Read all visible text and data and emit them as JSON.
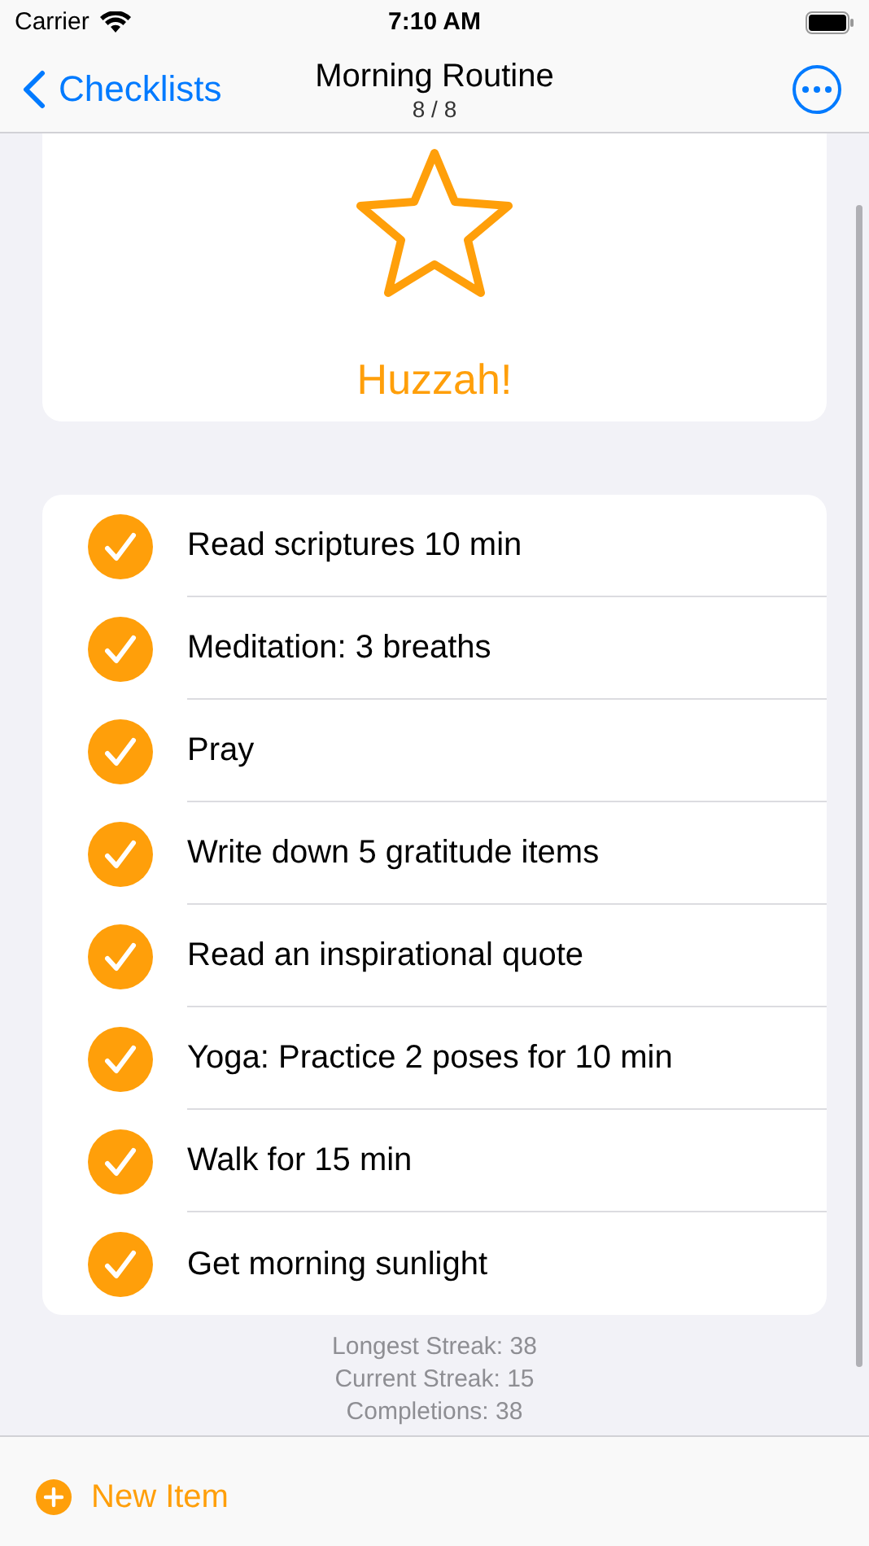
{
  "status_bar": {
    "carrier": "Carrier",
    "time": "7:10 AM"
  },
  "nav": {
    "back": "Checklists",
    "title": "Morning Routine",
    "subtitle": "8 / 8"
  },
  "banner": {
    "message": "Huzzah!"
  },
  "items": [
    {
      "label": "Read scriptures 10 min",
      "checked": true
    },
    {
      "label": "Meditation: 3 breaths",
      "checked": true
    },
    {
      "label": "Pray",
      "checked": true
    },
    {
      "label": "Write down 5 gratitude items",
      "checked": true
    },
    {
      "label": "Read an inspirational quote",
      "checked": true
    },
    {
      "label": "Yoga: Practice 2 poses for 10 min",
      "checked": true
    },
    {
      "label": "Walk for 15 min",
      "checked": true
    },
    {
      "label": "Get morning sunlight",
      "checked": true
    }
  ],
  "stats": [
    "Longest Streak: 38",
    "Current Streak: 15",
    "Completions: 38"
  ],
  "toolbar": {
    "new_item": "New Item"
  }
}
